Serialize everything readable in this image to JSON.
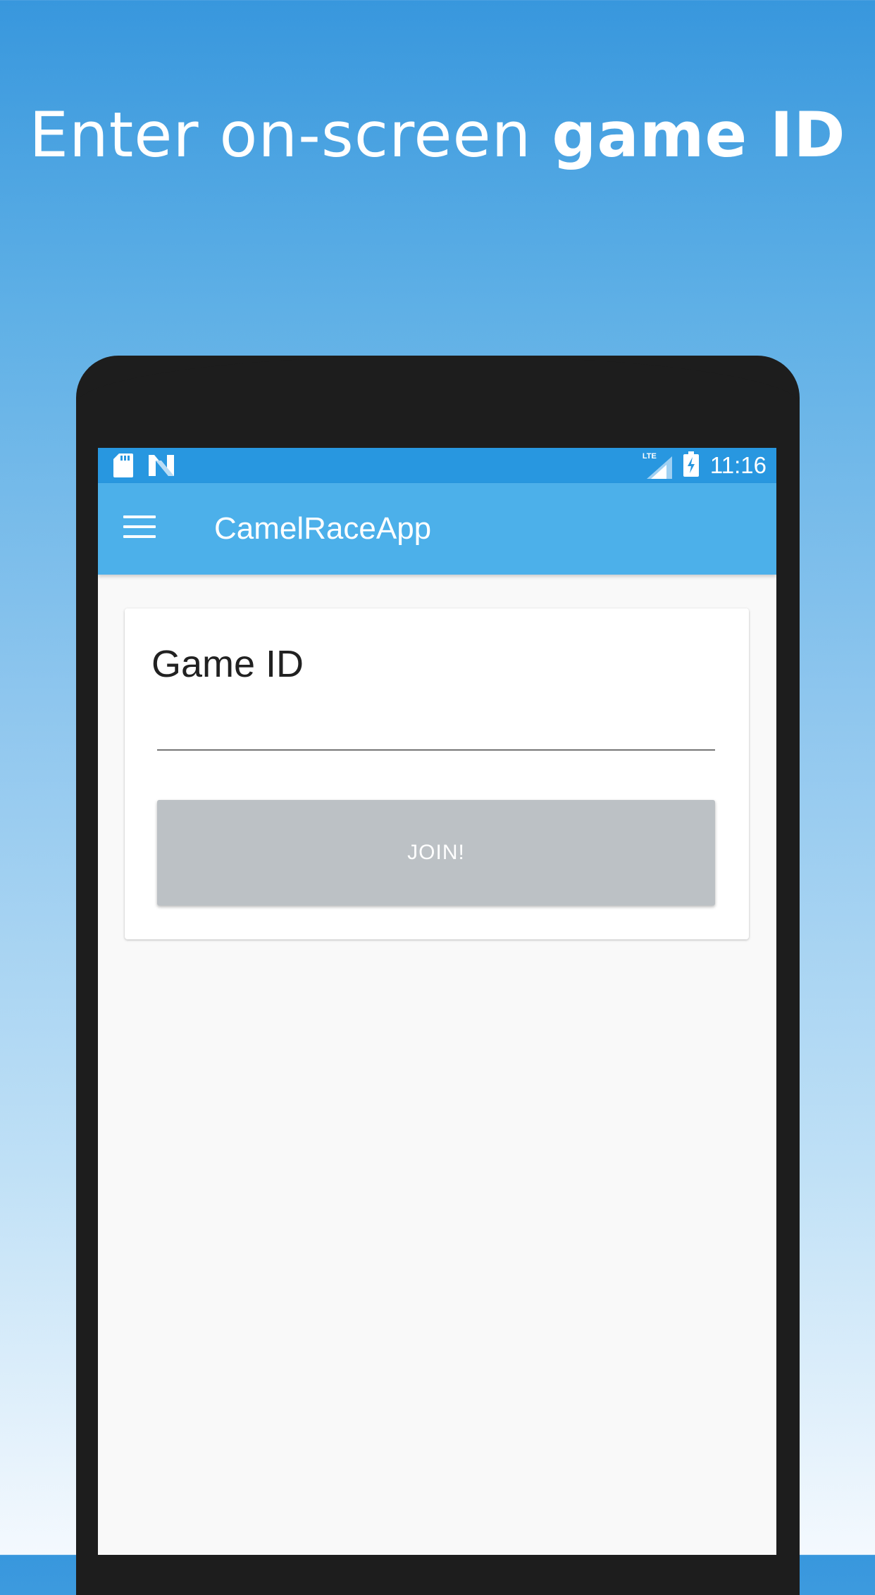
{
  "promo": {
    "headline_regular": "Enter on-screen ",
    "headline_bold": "game ID"
  },
  "status_bar": {
    "left_icons": [
      "sd-card-icon",
      "n-notification-icon"
    ],
    "network_label": "LTE",
    "right_icons": [
      "lte-signal-icon",
      "battery-charging-icon"
    ],
    "time": "11:16"
  },
  "app_bar": {
    "menu_icon": "hamburger-menu-icon",
    "title": "CamelRaceApp"
  },
  "form": {
    "label": "Game ID",
    "input_value": "",
    "join_label": "JOIN!"
  },
  "colors": {
    "status_bar": "#2897e0",
    "app_bar": "#4cb0ea",
    "button_disabled": "#bcc1c5",
    "phone_body": "#1d1d1d"
  }
}
